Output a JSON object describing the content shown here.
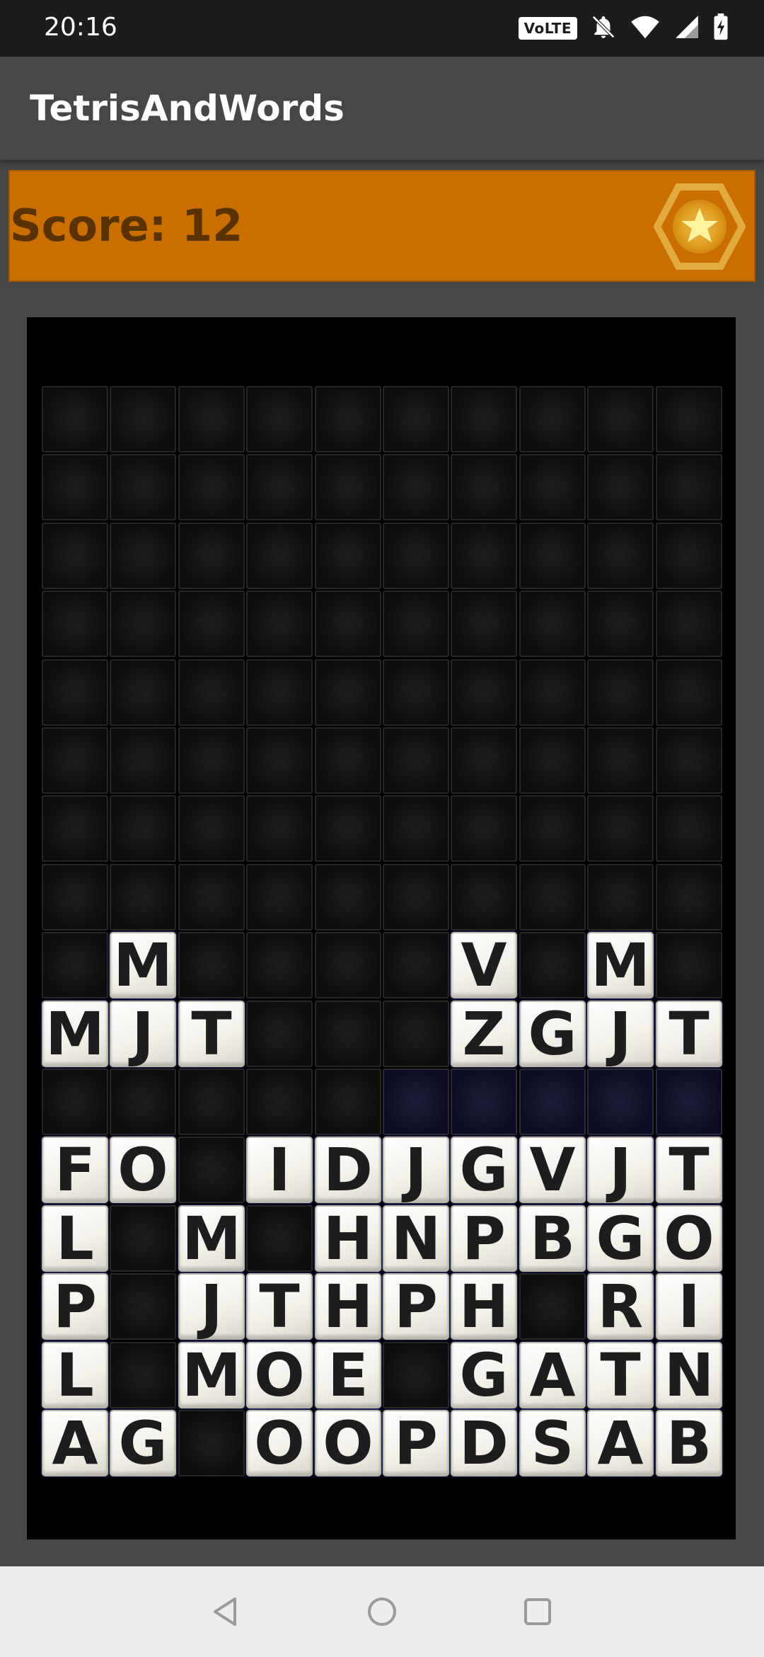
{
  "status_bar": {
    "time": "20:16",
    "volte": "VoLTE",
    "icons": [
      "volte-icon",
      "bell-off-icon",
      "wifi-icon",
      "signal-icon",
      "battery-charging-icon"
    ]
  },
  "app_bar": {
    "title": "TetrisAndWords"
  },
  "score": {
    "label": "Score: 12",
    "badge_icon": "star-hexagon-icon",
    "panel_color": "#c86f00"
  },
  "board": {
    "columns": 10,
    "rows": 16,
    "highlight_row": 10,
    "highlight_cols": [
      5,
      6,
      7,
      8,
      9
    ],
    "grid": [
      "..........",
      "..........",
      "..........",
      "..........",
      "..........",
      "..........",
      "..........",
      "..........",
      ".M....V.M.",
      "MJT...ZGJT",
      "..........",
      "FO.IDJGVJT",
      "L.M.HNPBGO",
      "P.JTHPH.RI",
      "L.MOE.GATN",
      "AG.OOPDSAB"
    ]
  },
  "nav_bar": {
    "buttons": [
      "back-icon",
      "home-icon",
      "recents-icon"
    ]
  }
}
